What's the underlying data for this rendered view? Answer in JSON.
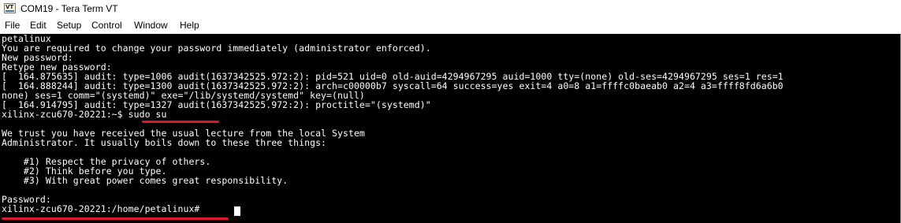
{
  "window": {
    "title": "COM19 - Tera Term VT",
    "icon_text": "VT"
  },
  "menu": {
    "items": [
      "File",
      "Edit",
      "Setup",
      "Control",
      "Window",
      "Help"
    ]
  },
  "terminal": {
    "lines": [
      "petalinux",
      "You are required to change your password immediately (administrator enforced).",
      "New password:",
      "Retype new password:",
      "[  164.875635] audit: type=1006 audit(1637342525.972:2): pid=521 uid=0 old-auid=4294967295 auid=1000 tty=(none) old-ses=4294967295 ses=1 res=1",
      "[  164.888244] audit: type=1300 audit(1637342525.972:2): arch=c00000b7 syscall=64 success=yes exit=4 a0=8 a1=ffffc0baeab0 a2=4 a3=ffff8fd6a6b0",
      "none) ses=1 comm=\"(systemd)\" exe=\"/lib/systemd/systemd\" key=(null)",
      "[  164.914795] audit: type=1327 audit(1637342525.972:2): proctitle=\"(systemd)\"",
      "xilinx-zcu670-20221:~$ sudo su",
      "",
      "We trust you have received the usual lecture from the local System",
      "Administrator. It usually boils down to these three things:",
      "",
      "    #1) Respect the privacy of others.",
      "    #2) Think before you type.",
      "    #3) With great power comes great responsibility.",
      "",
      "Password:",
      "xilinx-zcu670-20221:/home/petalinux# "
    ]
  },
  "colors": {
    "terminal_background": "#000000",
    "terminal_foreground": "#ffffff",
    "annotation_underline": "#e0162b"
  }
}
